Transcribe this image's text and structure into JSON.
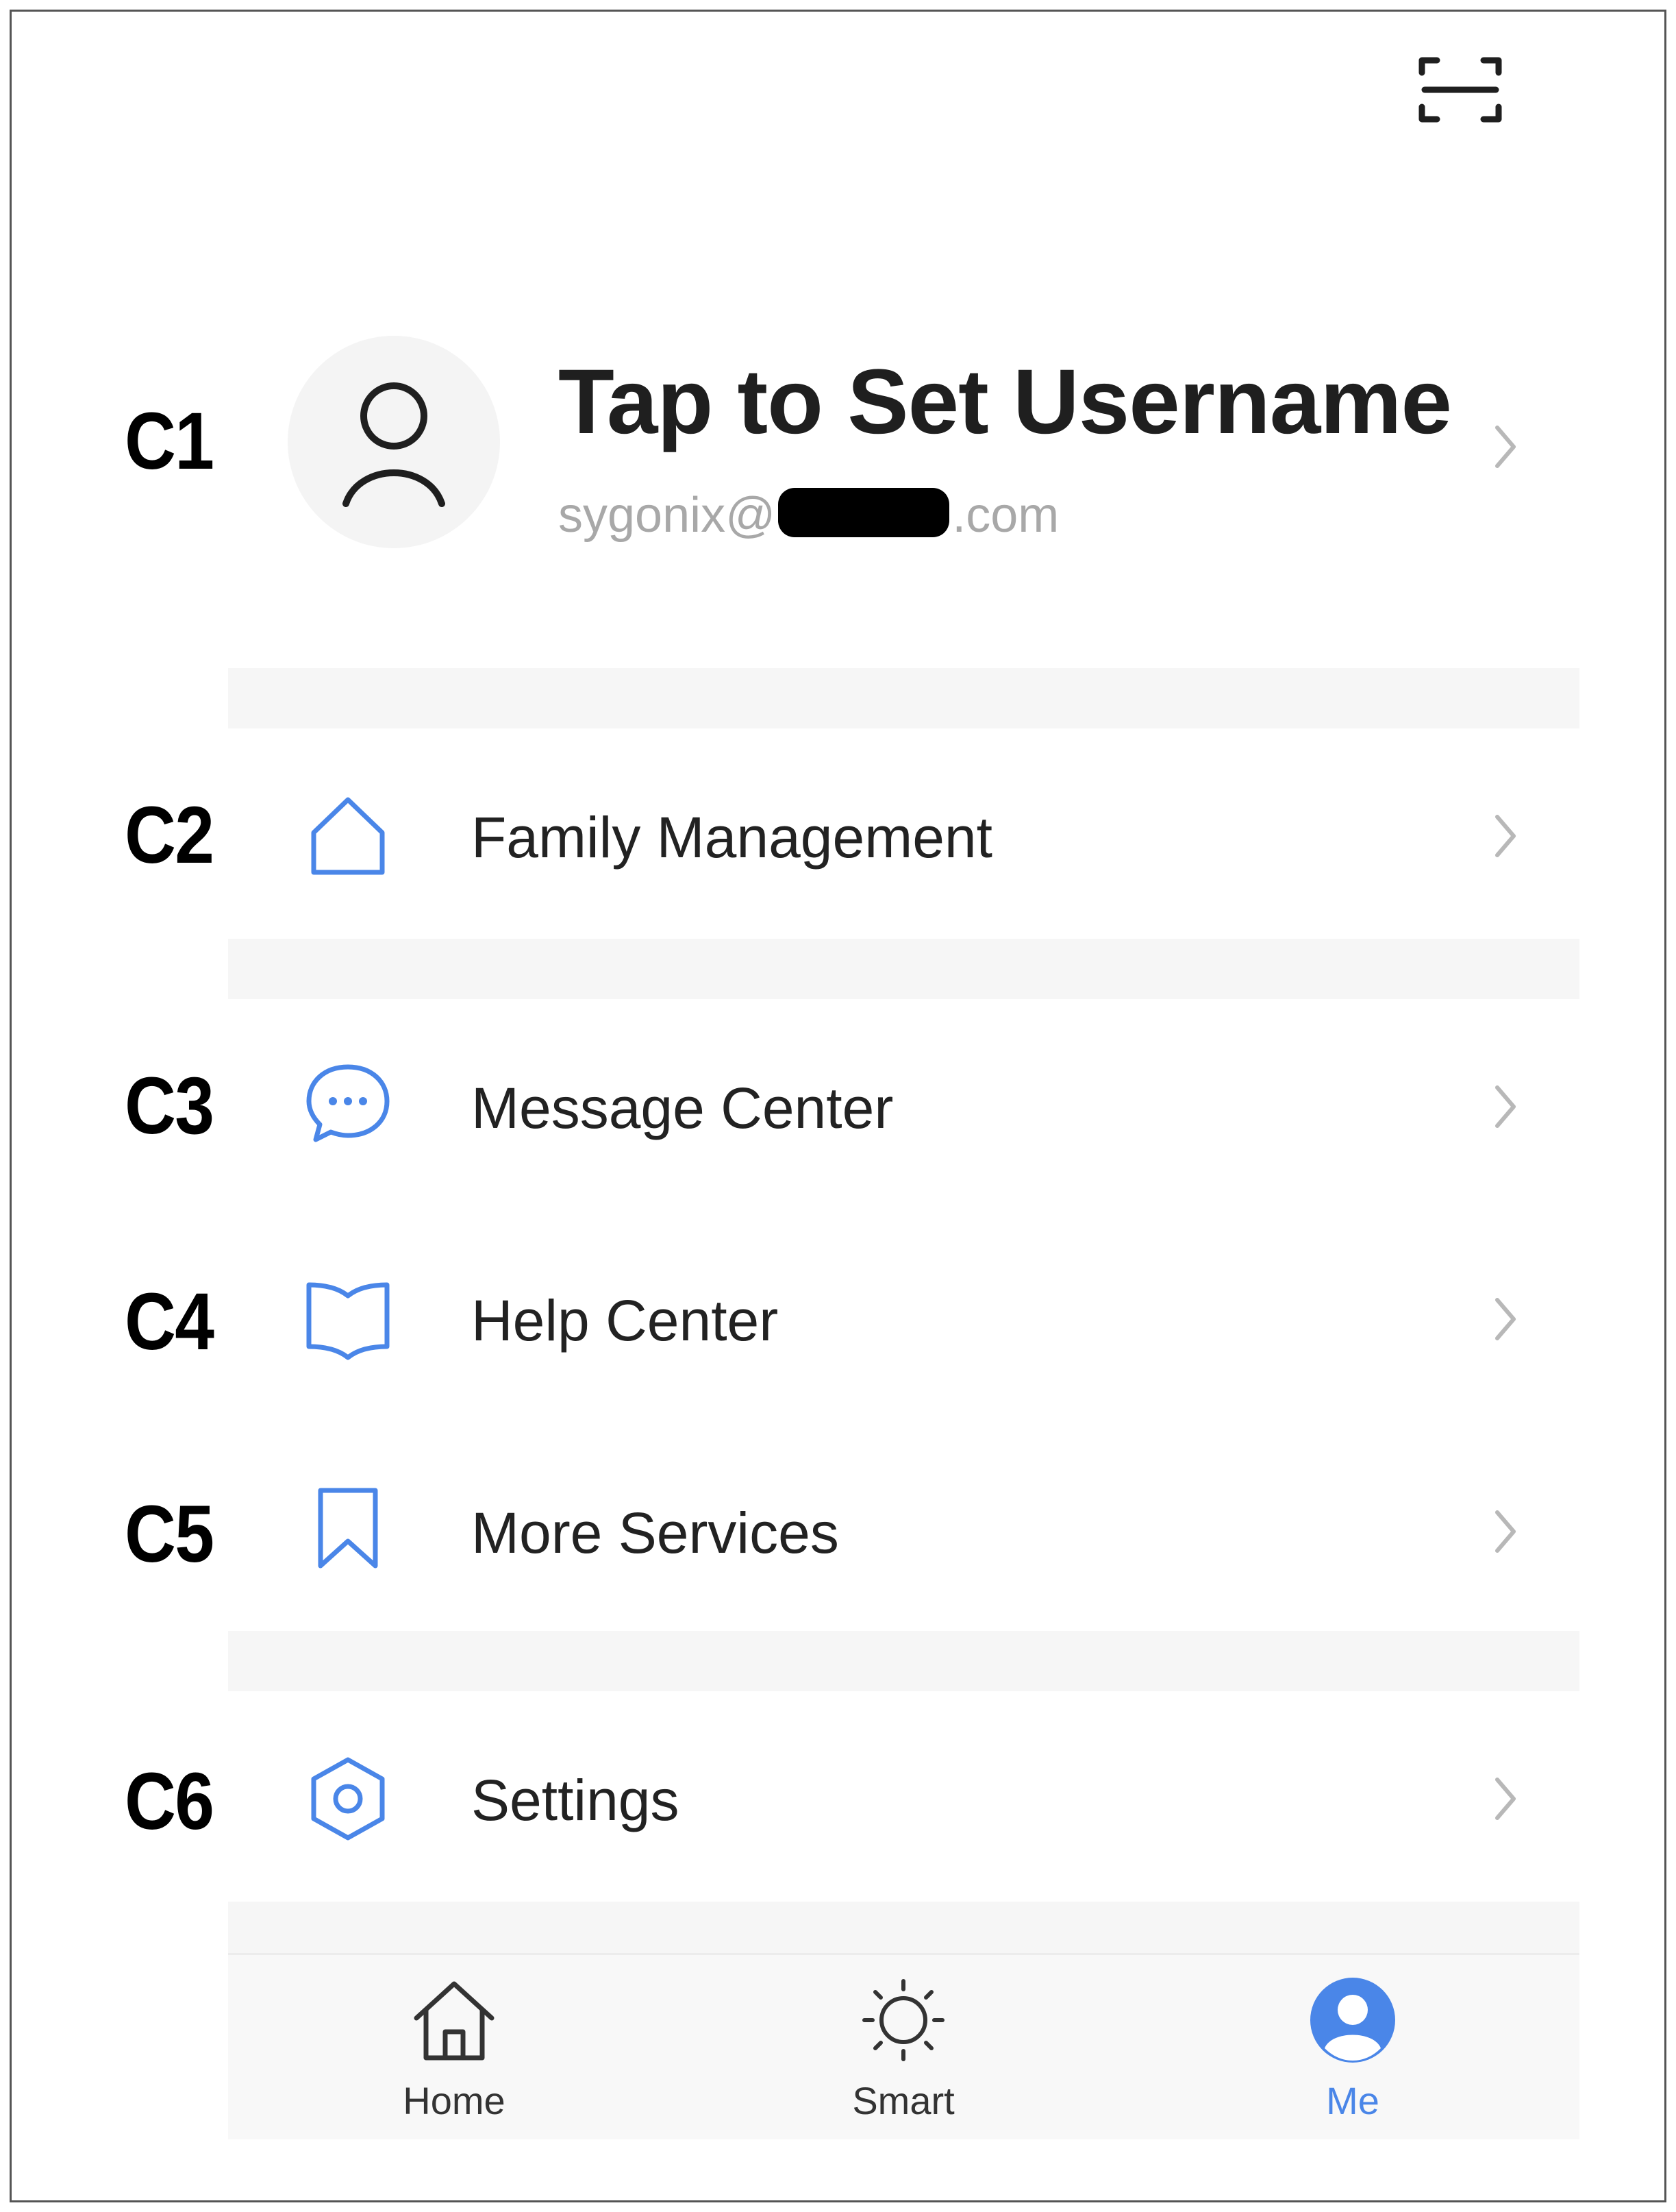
{
  "header": {
    "scan_icon": "scan-icon"
  },
  "callouts": [
    "C1",
    "C2",
    "C3",
    "C4",
    "C5",
    "C6"
  ],
  "profile": {
    "username": "Tap to Set Username",
    "email_prefix": "sygonix@",
    "email_suffix": ".com",
    "avatar_icon": "user-icon"
  },
  "menu": {
    "family_management": "Family Management",
    "message_center": "Message Center",
    "help_center": "Help Center",
    "more_services": "More Services",
    "settings": "Settings"
  },
  "tabbar": {
    "home": "Home",
    "smart": "Smart",
    "me": "Me",
    "active": "Me"
  },
  "colors": {
    "accent": "#4a86e8",
    "text": "#222222",
    "muted": "#a8a8a8",
    "band": "#f6f6f6"
  }
}
